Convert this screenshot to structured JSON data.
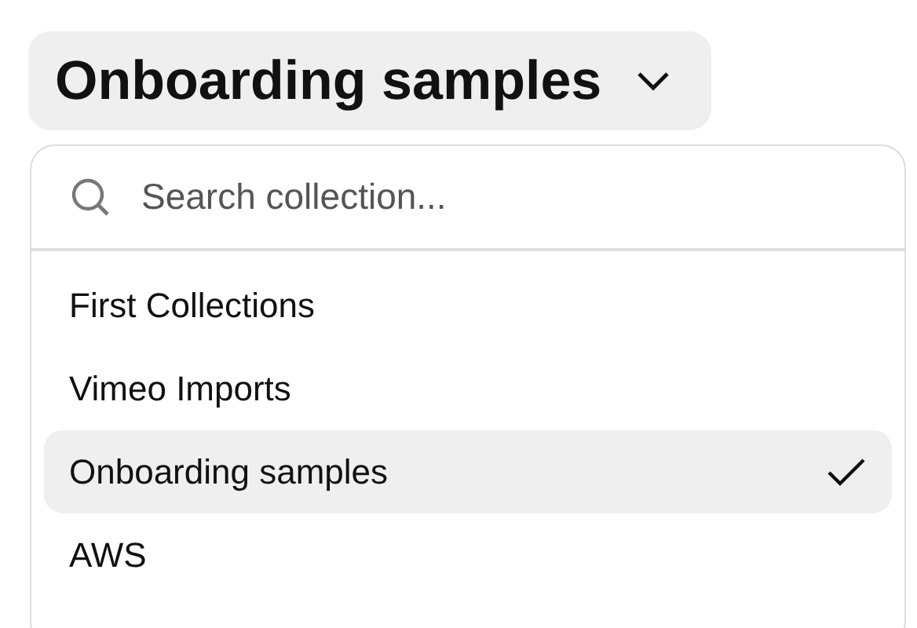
{
  "dropdown": {
    "label": "Onboarding samples"
  },
  "search": {
    "placeholder": "Search collection..."
  },
  "items": [
    {
      "label": "First Collections",
      "selected": false
    },
    {
      "label": "Vimeo Imports",
      "selected": false
    },
    {
      "label": "Onboarding samples",
      "selected": true
    },
    {
      "label": "AWS",
      "selected": false
    }
  ]
}
